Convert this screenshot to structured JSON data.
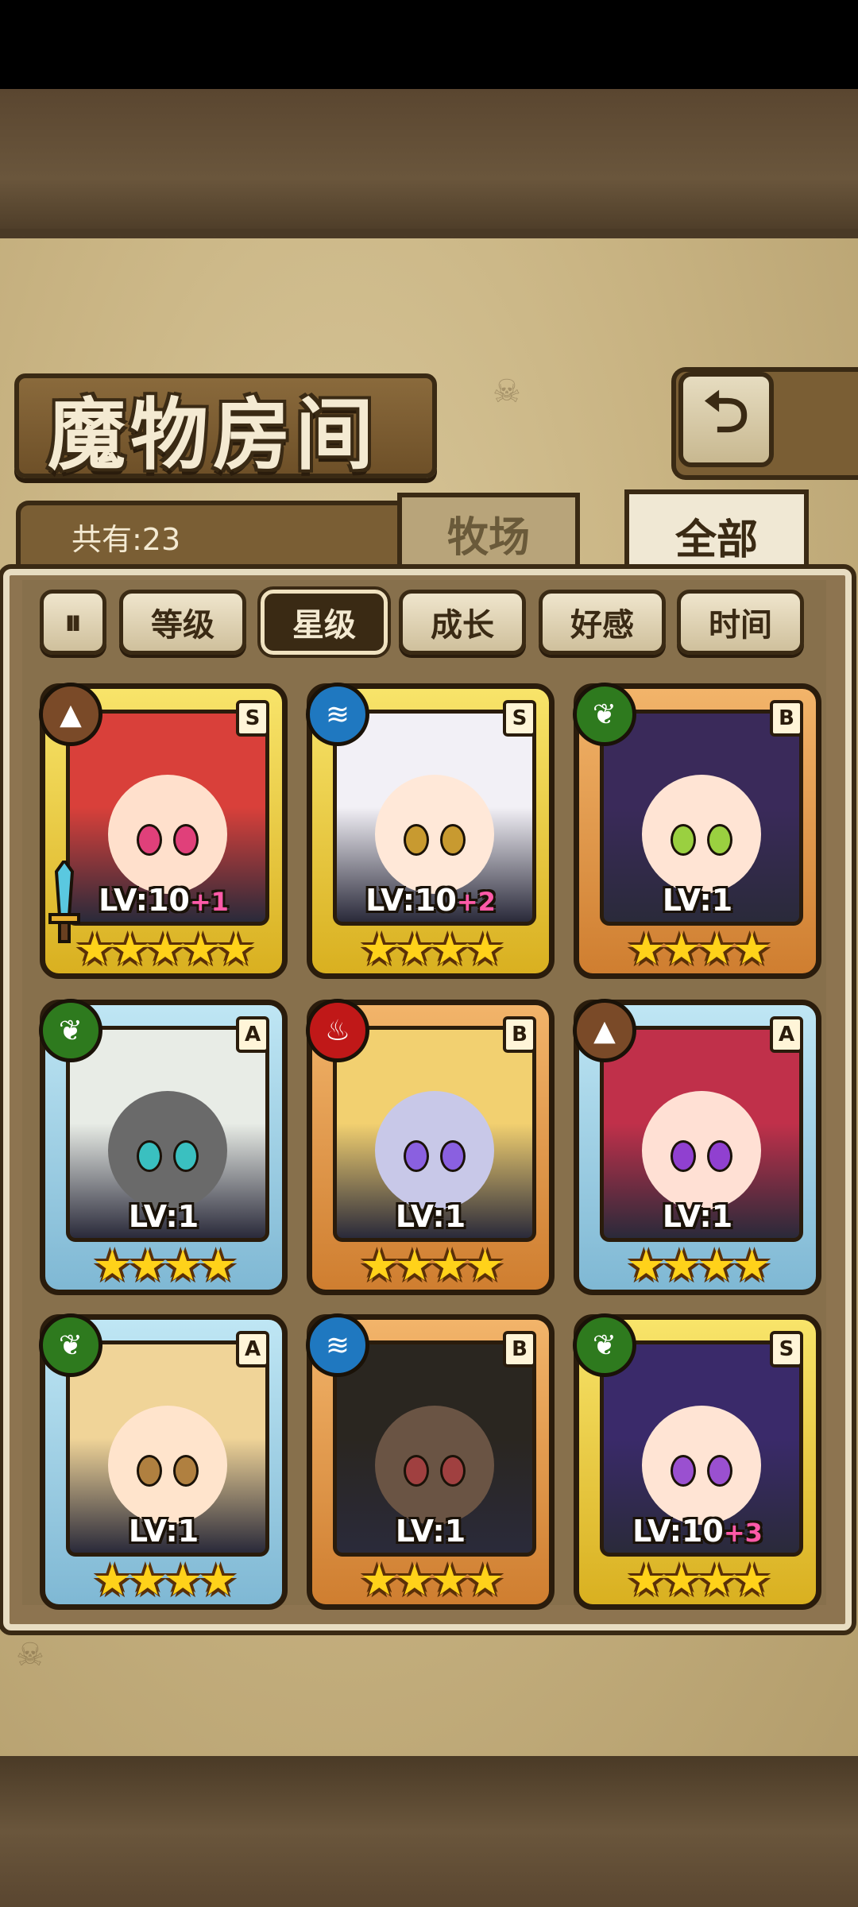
{
  "header": {
    "title": "魔物房间",
    "back_icon": "back-arrow-icon"
  },
  "count": {
    "label": "共有:23"
  },
  "tabs": [
    {
      "label": "牧场",
      "selected": false
    },
    {
      "label": "全部",
      "selected": true
    }
  ],
  "sort": {
    "toggle_icon": "pause-sort-icon",
    "options": [
      {
        "label": "等级",
        "active": false
      },
      {
        "label": "星级",
        "active": true
      },
      {
        "label": "成长",
        "active": false
      },
      {
        "label": "好感",
        "active": false
      },
      {
        "label": "时间",
        "active": false
      }
    ]
  },
  "monsters": [
    {
      "rank": "S",
      "element": "earth-icon",
      "level": "LV:10",
      "bonus": "+1",
      "stars": "★★★★★",
      "hair": "#d9403a",
      "skin": "#ffe0cc",
      "eyes": "#e0407a",
      "has_weapon": true
    },
    {
      "rank": "S",
      "element": "water-icon",
      "level": "LV:10",
      "bonus": "+2",
      "stars": "★★★★",
      "hair": "#f2f0f6",
      "skin": "#ffe8d8",
      "eyes": "#c89a30"
    },
    {
      "rank": "B",
      "element": "grass-icon",
      "level": "LV:1",
      "bonus": "",
      "stars": "★★★★",
      "hair": "#3a2a5a",
      "skin": "#ffe4d4",
      "eyes": "#9ad040"
    },
    {
      "rank": "A",
      "element": "grass-icon",
      "level": "LV:1",
      "bonus": "",
      "stars": "★★★★",
      "hair": "#e8ece6",
      "skin": "#6a6a6a",
      "eyes": "#3ac0c0"
    },
    {
      "rank": "B",
      "element": "fire-icon",
      "level": "LV:1",
      "bonus": "",
      "stars": "★★★★",
      "hair": "#f2d070",
      "skin": "#c8c8e8",
      "eyes": "#8a60e0"
    },
    {
      "rank": "A",
      "element": "earth-icon",
      "level": "LV:1",
      "bonus": "",
      "stars": "★★★★",
      "hair": "#c0304a",
      "skin": "#ffe0d4",
      "eyes": "#9040d0"
    },
    {
      "rank": "A",
      "element": "grass-icon",
      "level": "LV:1",
      "bonus": "",
      "stars": "★★★★",
      "hair": "#f0d498",
      "skin": "#ffe4cc",
      "eyes": "#b08040"
    },
    {
      "rank": "B",
      "element": "water-icon",
      "level": "LV:1",
      "bonus": "",
      "stars": "★★★★",
      "hair": "#2a2620",
      "skin": "#6a5444",
      "eyes": "#a04040"
    },
    {
      "rank": "S",
      "element": "grass-icon",
      "level": "LV:10",
      "bonus": "+3",
      "stars": "★★★★",
      "hair": "#3a2a6a",
      "skin": "#ffe4d4",
      "eyes": "#9a50d0"
    }
  ]
}
